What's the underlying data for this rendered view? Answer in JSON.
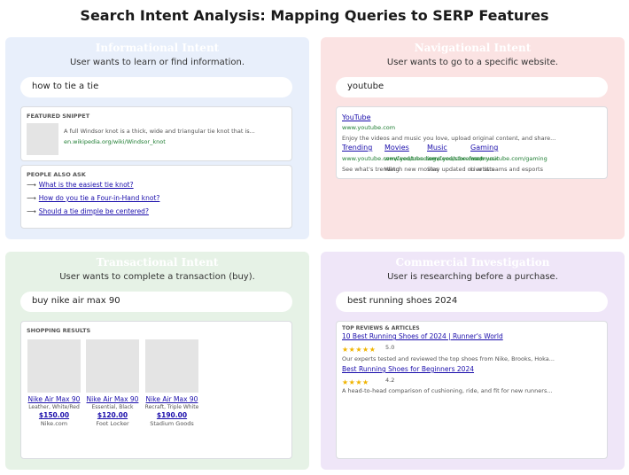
{
  "title": "Search Intent Analysis: Mapping Queries to SERP Features",
  "informational": {
    "heading": "Informational Intent",
    "subtitle": "User wants to learn or find information.",
    "query": "how to tie a tie",
    "featured_snippet": {
      "label": "FEATURED SNIPPET",
      "text": "A full Windsor knot is a thick, wide and triangular tie knot that is...",
      "url": "en.wikipedia.org/wiki/Windsor_knot"
    },
    "people_also_ask": {
      "label": "PEOPLE ALSO ASK",
      "arrow": "⟶",
      "questions": [
        "What is the easiest tie knot?",
        "How do you tie a Four-in-Hand knot?",
        "Should a tie dimple be centered?"
      ]
    }
  },
  "navigational": {
    "heading": "Navigational Intent",
    "subtitle": "User wants to go to a specific website.",
    "query": "youtube",
    "result": {
      "title": "YouTube",
      "url": "www.youtube.com",
      "description": "Enjoy the videos and music you love, upload original content, and share..."
    },
    "sitelinks": [
      {
        "title": "Trending",
        "url": "www.youtube.com/feed/trending",
        "desc": "See what's trending"
      },
      {
        "title": "Movies",
        "url": "www.youtube.com/feed/storefront",
        "desc": "Watch new movies"
      },
      {
        "title": "Music",
        "url": "www.youtube.com/music",
        "desc": "Stay updated on artists"
      },
      {
        "title": "Gaming",
        "url": "www.youtube.com/gaming",
        "desc": "Live streams and esports"
      }
    ]
  },
  "transactional": {
    "heading": "Transactional Intent",
    "subtitle": "User wants to complete a transaction (buy).",
    "query": "buy nike air max 90",
    "shopping": {
      "label": "SHOPPING RESULTS",
      "products": [
        {
          "name": "Nike Air Max 90",
          "desc": "Leather, White/Red",
          "price": "$150.00",
          "store": "Nike.com"
        },
        {
          "name": "Nike Air Max 90",
          "desc": "Essential, Black",
          "price": "$120.00",
          "store": "Foot Locker"
        },
        {
          "name": "Nike Air Max 90",
          "desc": "Recraft, Triple White",
          "price": "$190.00",
          "store": "Stadium Goods"
        }
      ]
    }
  },
  "commercial": {
    "heading": "Commercial Investigation",
    "subtitle": "User is researching before a purchase.",
    "query": "best running shoes 2024",
    "reviews": {
      "label": "TOP REVIEWS & ARTICLES",
      "items": [
        {
          "title": "10 Best Running Shoes of 2024 | Runner's World",
          "stars": "★★★★★",
          "rating": "5.0",
          "desc": "Our experts tested and reviewed the top shoes from Nike, Brooks, Hoka..."
        },
        {
          "title": "Best Running Shoes for Beginners 2024",
          "stars": "★★★★",
          "rating": "4.2",
          "desc": "A head-to-head comparison of cushioning, ride, and fit for new runners..."
        }
      ]
    }
  }
}
